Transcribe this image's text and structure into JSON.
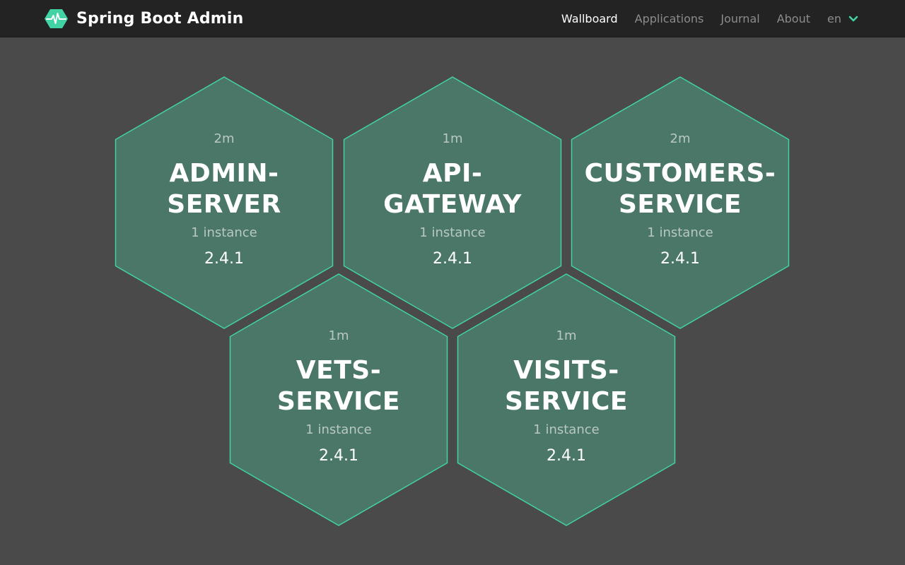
{
  "header": {
    "brand": "Spring Boot Admin",
    "nav": [
      "Wallboard",
      "Applications",
      "Journal",
      "About"
    ],
    "active_nav": "Wallboard",
    "language": "en"
  },
  "colors": {
    "navbar_bg": "#232323",
    "page_bg": "#4a4a4a",
    "hex_fill": "#4a7767",
    "hex_border": "#42d3a5",
    "accent": "#42d3a5"
  },
  "applications": [
    {
      "name_line1": "ADMIN-",
      "name_line2": "SERVER",
      "time": "2m",
      "instances": "1 instance",
      "version": "2.4.1",
      "status": "UP"
    },
    {
      "name_line1": "API-",
      "name_line2": "GATEWAY",
      "time": "1m",
      "instances": "1 instance",
      "version": "2.4.1",
      "status": "UP"
    },
    {
      "name_line1": "CUSTOMERS-",
      "name_line2": "SERVICE",
      "time": "2m",
      "instances": "1 instance",
      "version": "2.4.1",
      "status": "UP"
    },
    {
      "name_line1": "VETS-",
      "name_line2": "SERVICE",
      "time": "1m",
      "instances": "1 instance",
      "version": "2.4.1",
      "status": "UP"
    },
    {
      "name_line1": "VISITS-",
      "name_line2": "SERVICE",
      "time": "1m",
      "instances": "1 instance",
      "version": "2.4.1",
      "status": "UP"
    }
  ]
}
